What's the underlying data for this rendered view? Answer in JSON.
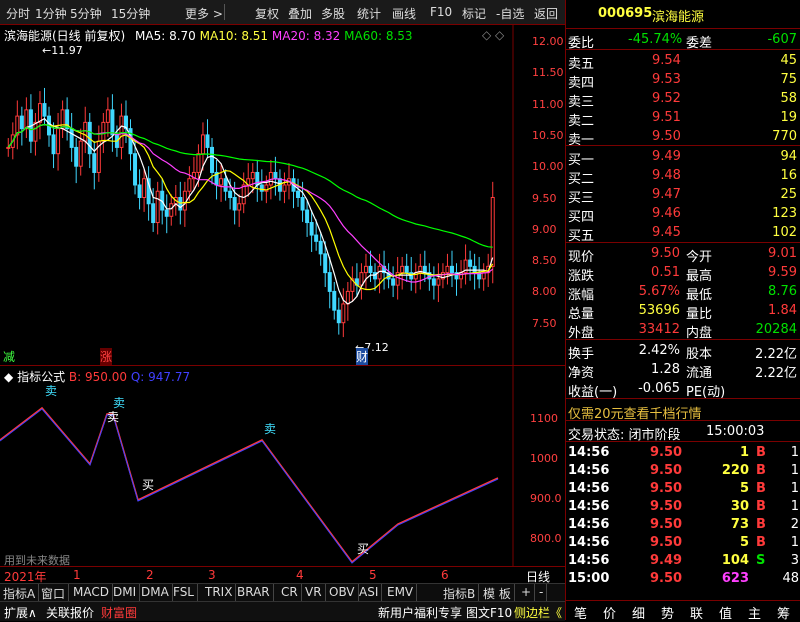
{
  "toolbar": {
    "items": [
      "分时",
      "1分钟",
      "5分钟",
      "15分钟",
      "更多 >",
      "复权",
      "叠加",
      "多股",
      "统计",
      "画线",
      "F10",
      "标记",
      "-自选",
      "返回"
    ]
  },
  "main_chart": {
    "title": "滨海能源(日线 前复权)",
    "ma_labels": [
      "MA5: 8.70",
      "MA10: 8.51",
      "MA20: 8.32",
      "MA60: 8.53"
    ],
    "ma_colors": [
      "#ffffff",
      "#ffff00",
      "#ff40ff",
      "#00ff00"
    ],
    "y_ticks": [
      "12.00",
      "11.50",
      "11.00",
      "10.50",
      "10.00",
      "9.50",
      "9.00",
      "8.50",
      "8.00",
      "7.50"
    ],
    "high_label": "11.97",
    "low_label": "7.12",
    "marks": {
      "jian": "减",
      "zhang": "涨",
      "cai": "财"
    }
  },
  "indicator": {
    "name": "指标公式",
    "b_label": "B: 950.00",
    "q_label": "Q: 947.77",
    "y_ticks": [
      "1100",
      "1000",
      "900.0",
      "800.0"
    ],
    "signals": [
      "卖",
      "卖",
      "买",
      "卖",
      "买"
    ],
    "note": "用到未来数据"
  },
  "date_axis": {
    "labels": [
      "2021年",
      "1",
      "2",
      "3",
      "4",
      "5",
      "6"
    ],
    "period": "日线"
  },
  "bottom_tabs": [
    "指标A",
    "窗口",
    "MACD",
    "DMI",
    "DMA",
    "FSL",
    "TRIX",
    "BRAR",
    "CR",
    "VR",
    "OBV",
    "ASI",
    "EMV",
    "指标B",
    "模 板",
    "+",
    "-"
  ],
  "status_bar": {
    "items": [
      "扩展∧",
      "关联报价",
      "财富圈"
    ],
    "promo": "新用户福利专享",
    "right": [
      "图文F10",
      "侧边栏《"
    ]
  },
  "quote": {
    "code": "000695",
    "name": "滨海能源",
    "weibi_label": "委比",
    "weibi": "-45.74%",
    "weicha_label": "委差",
    "weicha": "-607",
    "sells": [
      [
        "卖五",
        "9.54",
        "45"
      ],
      [
        "卖四",
        "9.53",
        "75"
      ],
      [
        "卖三",
        "9.52",
        "58"
      ],
      [
        "卖二",
        "9.51",
        "19"
      ],
      [
        "卖一",
        "9.50",
        "770"
      ]
    ],
    "buys": [
      [
        "买一",
        "9.49",
        "94"
      ],
      [
        "买二",
        "9.48",
        "16"
      ],
      [
        "买三",
        "9.47",
        "25"
      ],
      [
        "买四",
        "9.46",
        "123"
      ],
      [
        "买五",
        "9.45",
        "102"
      ]
    ],
    "stats": [
      [
        "现价",
        "9.50",
        "今开",
        "9.01"
      ],
      [
        "涨跌",
        "0.51",
        "最高",
        "9.59"
      ],
      [
        "涨幅",
        "5.67%",
        "最低",
        "8.76"
      ],
      [
        "总量",
        "53696",
        "量比",
        "1.84"
      ],
      [
        "外盘",
        "33412",
        "内盘",
        "20284"
      ]
    ],
    "stats2": [
      [
        "换手",
        "2.42%",
        "股本",
        "2.22亿"
      ],
      [
        "净资",
        "1.28",
        "流通",
        "2.22亿"
      ],
      [
        "收益(一)",
        "-0.065",
        "PE(动)",
        ""
      ]
    ],
    "promo": "仅需20元查看千档行情",
    "trade_status": "交易状态: 闭市阶段",
    "trade_time": "15:00:03",
    "ticks": [
      [
        "14:56",
        "9.50",
        "1",
        "B",
        "1"
      ],
      [
        "14:56",
        "9.50",
        "220",
        "B",
        "1"
      ],
      [
        "14:56",
        "9.50",
        "5",
        "B",
        "1"
      ],
      [
        "14:56",
        "9.50",
        "30",
        "B",
        "1"
      ],
      [
        "14:56",
        "9.50",
        "73",
        "B",
        "2"
      ],
      [
        "14:56",
        "9.50",
        "5",
        "B",
        "1"
      ],
      [
        "14:56",
        "9.49",
        "104",
        "S",
        "3"
      ],
      [
        "15:00",
        "9.50",
        "623",
        "",
        "48"
      ]
    ]
  },
  "right_tabs": [
    "笔",
    "价",
    "细",
    "势",
    "联",
    "值",
    "主",
    "筹"
  ]
}
